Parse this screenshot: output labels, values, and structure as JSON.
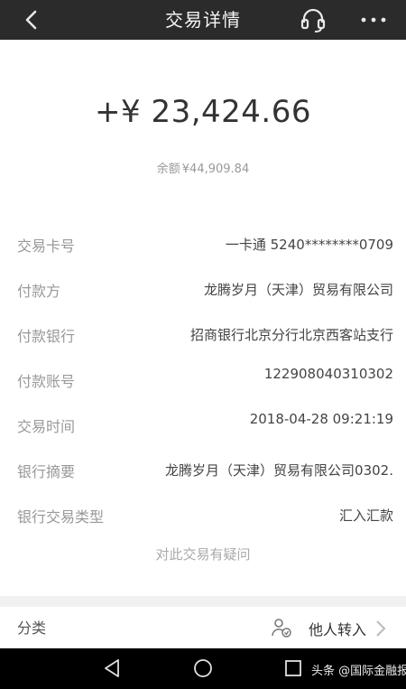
{
  "header": {
    "title": "交易详情"
  },
  "transaction": {
    "amount": "+¥ 23,424.66",
    "balance_label": "余额",
    "balance_value": "¥44,909.84"
  },
  "details": [
    {
      "label": "交易卡号",
      "value": "一卡通 5240********0709"
    },
    {
      "label": "付款方",
      "value": "龙腾岁月（天津）贸易有限公司"
    },
    {
      "label": "付款银行",
      "value": "招商银行北京分行北京西客站支行"
    },
    {
      "label": "付款账号",
      "value": "122908040310302"
    },
    {
      "label": "交易时间",
      "value": "2018-04-28 09:21:19"
    },
    {
      "label": "银行摘要",
      "value": "龙腾岁月（天津）贸易有限公司0302."
    },
    {
      "label": "银行交易类型",
      "value": "汇入汇款"
    }
  ],
  "question_link": "对此交易有疑问",
  "category": {
    "label": "分类",
    "value": "他人转入"
  },
  "watermark": "头条 @国际金融报"
}
